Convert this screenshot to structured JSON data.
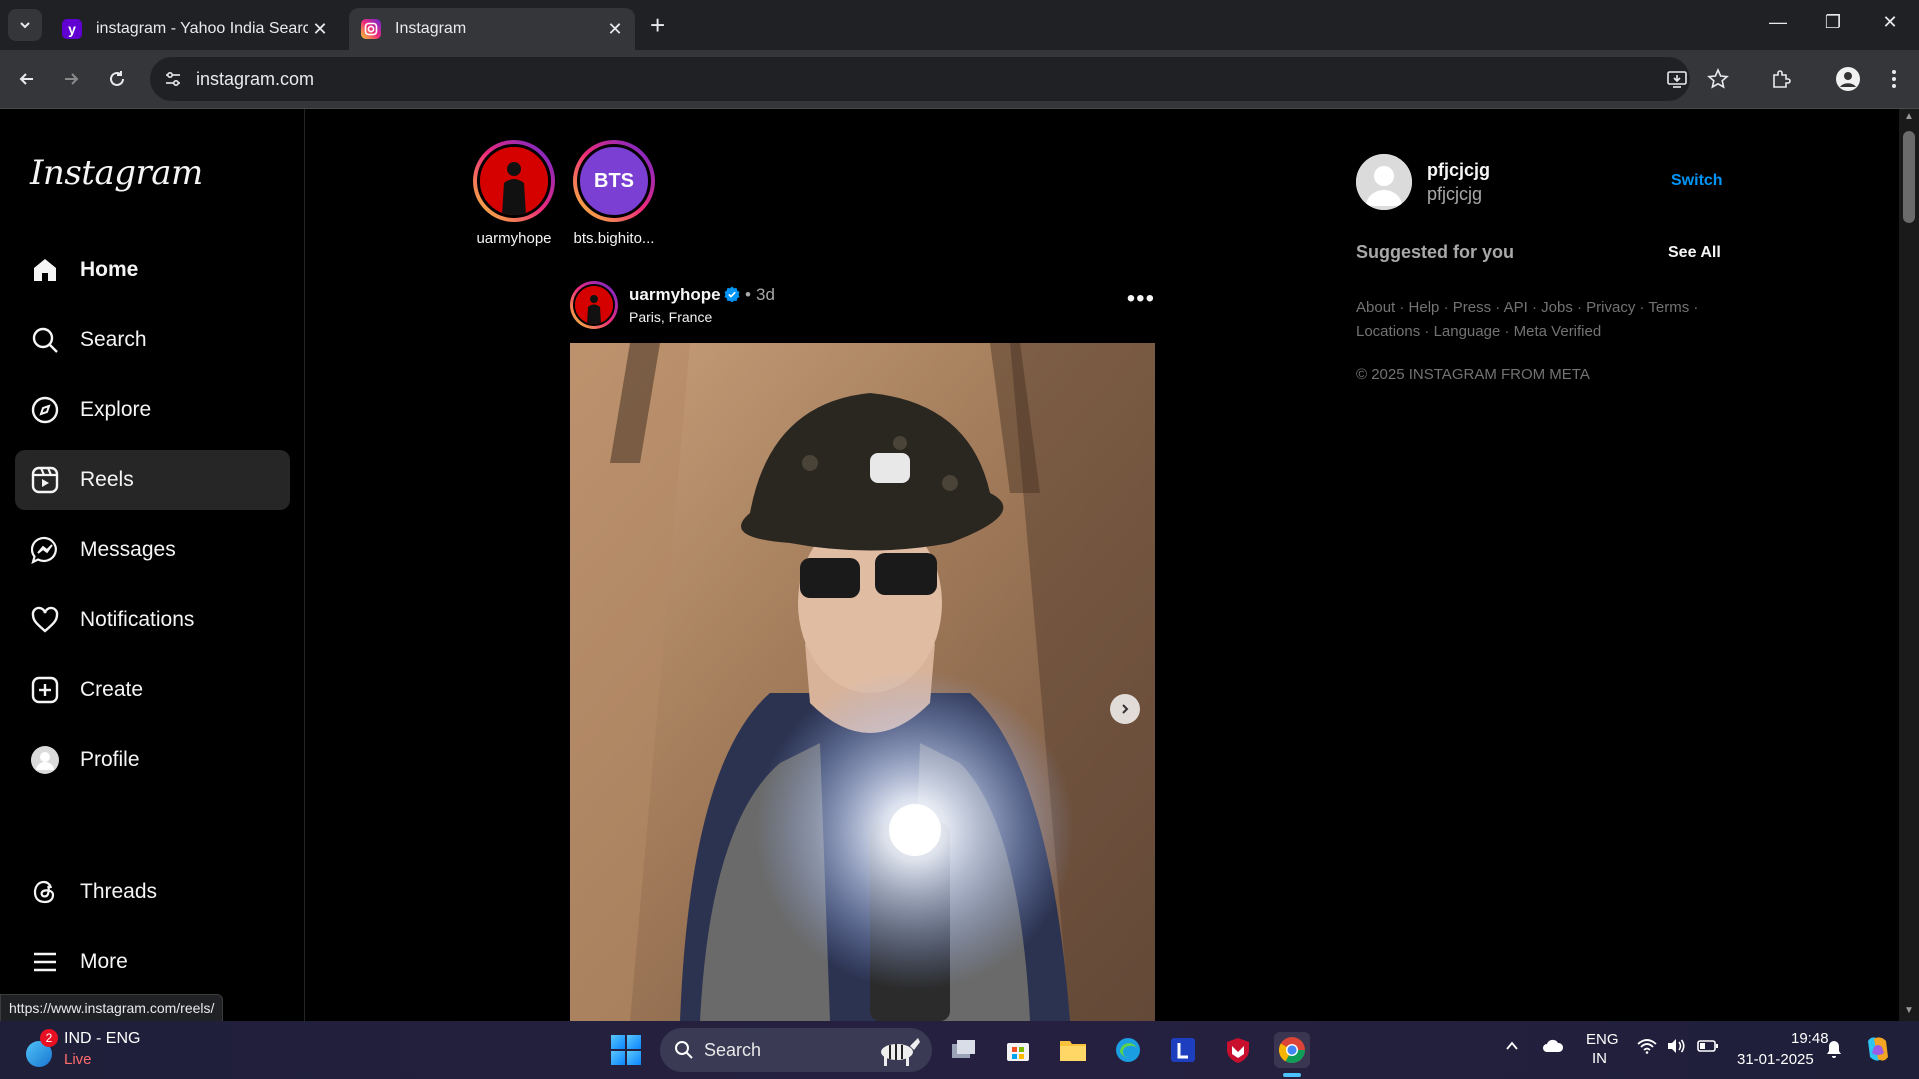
{
  "browser": {
    "tabs": [
      {
        "title": "instagram - Yahoo India Search",
        "favicon": "yahoo-icon",
        "active": false
      },
      {
        "title": "Instagram",
        "favicon": "instagram-icon",
        "active": true
      }
    ],
    "url": "instagram.com",
    "status_url": "https://www.instagram.com/reels/"
  },
  "sidebar": {
    "logo": "Instagram",
    "items": [
      {
        "label": "Home",
        "icon": "home-icon"
      },
      {
        "label": "Search",
        "icon": "search-icon"
      },
      {
        "label": "Explore",
        "icon": "explore-icon"
      },
      {
        "label": "Reels",
        "icon": "reels-icon"
      },
      {
        "label": "Messages",
        "icon": "messages-icon"
      },
      {
        "label": "Notifications",
        "icon": "heart-icon"
      },
      {
        "label": "Create",
        "icon": "create-icon"
      },
      {
        "label": "Profile",
        "icon": "profile-icon"
      },
      {
        "label": "Threads",
        "icon": "threads-icon"
      },
      {
        "label": "More",
        "icon": "menu-icon"
      }
    ]
  },
  "stories": [
    {
      "name": "uarmyhope"
    },
    {
      "name": "bts.bighito...",
      "avatar_text": "BTS"
    }
  ],
  "post": {
    "username": "uarmyhope",
    "separator": "•",
    "time": "3d",
    "location": "Paris, France",
    "more": "•••"
  },
  "right": {
    "username": "pfjcjcjg",
    "fullname": "pfjcjcjg",
    "switch": "Switch",
    "suggested": "Suggested for you",
    "see_all": "See All",
    "footer_links": [
      "About",
      "Help",
      "Press",
      "API",
      "Jobs",
      "Privacy",
      "Terms",
      "Locations",
      "Language",
      "Meta Verified"
    ],
    "copyright": "© 2025 INSTAGRAM FROM META"
  },
  "taskbar": {
    "weather_badge": "2",
    "weather_title": "IND - ENG",
    "weather_sub": "Live",
    "search": "Search",
    "lang_line1": "ENG",
    "lang_line2": "IN",
    "time": "19:48",
    "date": "31-01-2025"
  },
  "colors": {
    "background": "#000000",
    "accent": "#0095f6",
    "selected_nav": "#262626"
  }
}
